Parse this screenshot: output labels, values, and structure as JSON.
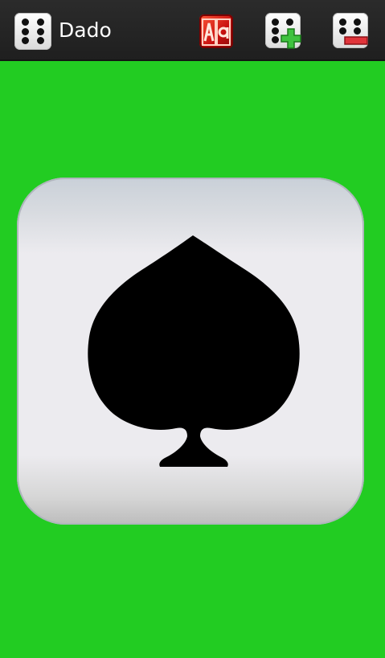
{
  "app": {
    "title": "Dado"
  },
  "toolbar": {
    "actions": [
      {
        "name": "letter-dice-button",
        "icon": "letter-block-icon"
      },
      {
        "name": "add-die-button",
        "icon": "die-add-icon"
      },
      {
        "name": "remove-die-button",
        "icon": "die-remove-icon"
      }
    ]
  },
  "die": {
    "face": "spade",
    "icon": "spade-icon"
  },
  "colors": {
    "background": "#22cc22",
    "toolbar": "#222222",
    "add_badge": "#3fc23f",
    "remove_badge": "#e0343a",
    "letter_block": "#c8100f"
  }
}
